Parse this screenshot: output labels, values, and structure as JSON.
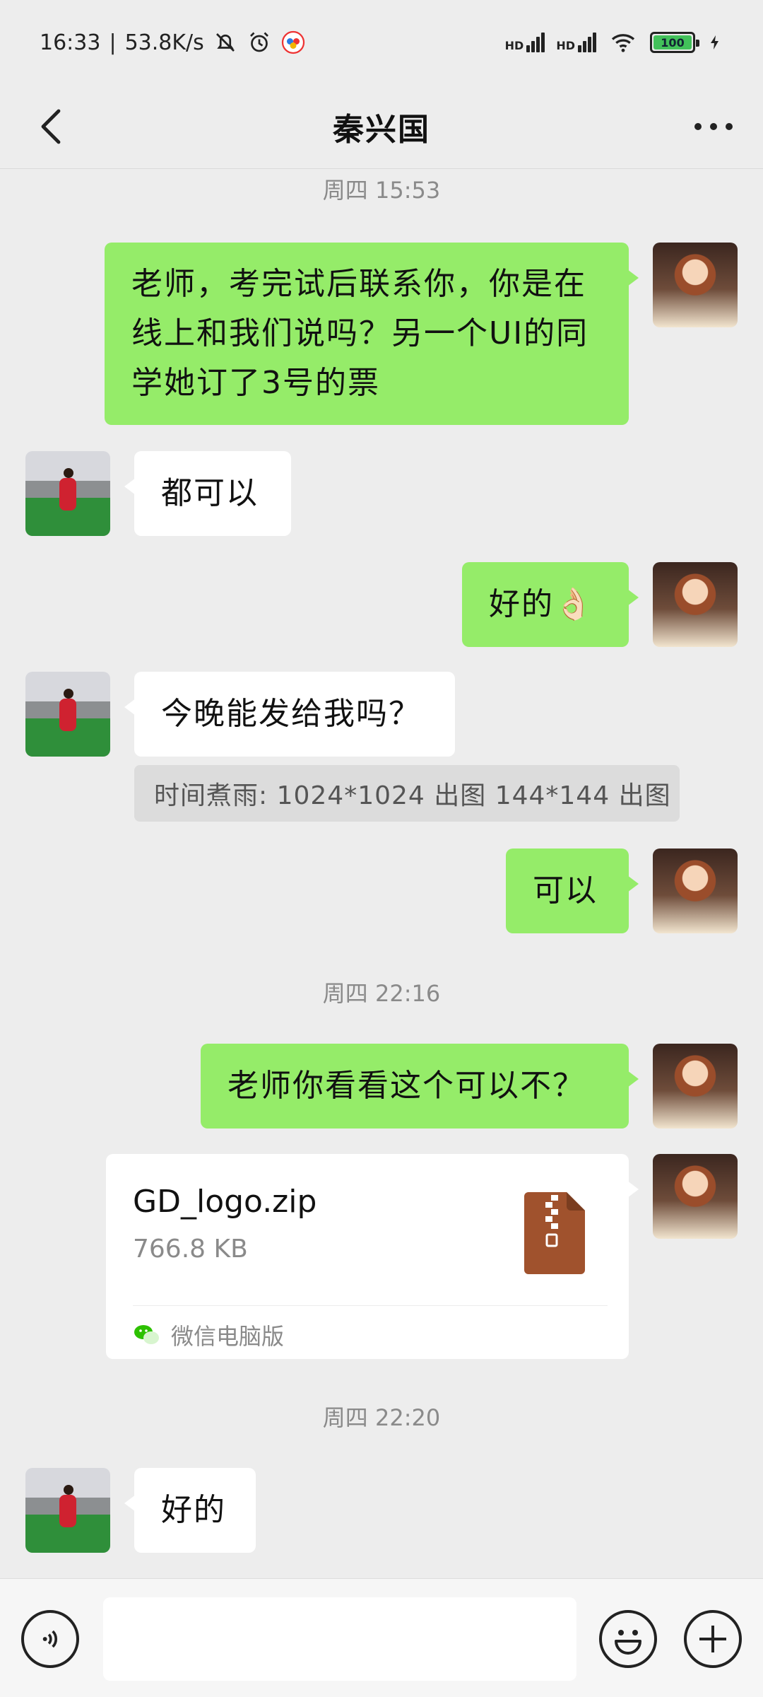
{
  "status_bar": {
    "time": "16:33",
    "net_speed": "53.8K/s",
    "hd_label_1": "HD",
    "hd_label_2": "HD",
    "battery": "100"
  },
  "header": {
    "title": "秦兴国"
  },
  "messages": {
    "time_1": "周四 15:53",
    "m1": "老师，考完试后联系你，你是在线上和我们说吗？另一个UI的同学她订了3号的票",
    "m2": "都可以",
    "m3": "好的👌🏻",
    "m4": "今晚能发给我吗？",
    "quote": "时间煮雨: 1024*1024 出图 144*144 出图",
    "m5": "可以",
    "time_2": "周四 22:16",
    "m6": "老师你看看这个可以不？",
    "file": {
      "name": "GD_logo.zip",
      "size": "766.8 KB",
      "source": "微信电脑版"
    },
    "time_3": "周四 22:20",
    "m7": "好的"
  },
  "input": {
    "placeholder": ""
  },
  "colors": {
    "bubble_me": "#95ec69",
    "bubble_other": "#ffffff",
    "background": "#ededed"
  }
}
